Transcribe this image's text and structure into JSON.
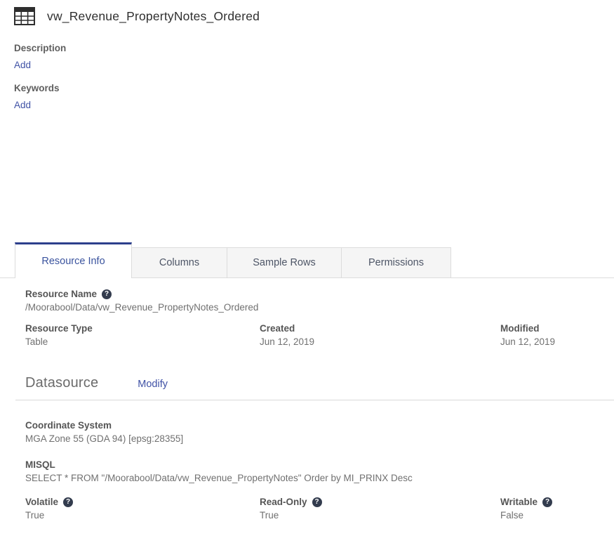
{
  "header": {
    "title": "vw_Revenue_PropertyNotes_Ordered"
  },
  "meta": {
    "description_label": "Description",
    "description_add": "Add",
    "keywords_label": "Keywords",
    "keywords_add": "Add"
  },
  "tabs": [
    {
      "label": "Resource Info",
      "active": true
    },
    {
      "label": "Columns",
      "active": false
    },
    {
      "label": "Sample Rows",
      "active": false
    },
    {
      "label": "Permissions",
      "active": false
    }
  ],
  "resource_info": {
    "resource_name": {
      "label": "Resource Name",
      "value": "/Moorabool/Data/vw_Revenue_PropertyNotes_Ordered"
    },
    "resource_type": {
      "label": "Resource Type",
      "value": "Table"
    },
    "created": {
      "label": "Created",
      "value": "Jun 12, 2019"
    },
    "modified": {
      "label": "Modified",
      "value": "Jun 12, 2019"
    }
  },
  "datasource": {
    "heading": "Datasource",
    "modify_label": "Modify",
    "coordinate_system": {
      "label": "Coordinate System",
      "value": "MGA Zone 55 (GDA 94) [epsg:28355]"
    },
    "misql": {
      "label": "MISQL",
      "value": "SELECT * FROM \"/Moorabool/Data/vw_Revenue_PropertyNotes\" Order by MI_PRINX Desc"
    },
    "volatile": {
      "label": "Volatile",
      "value": "True"
    },
    "read_only": {
      "label": "Read-Only",
      "value": "True"
    },
    "writable": {
      "label": "Writable",
      "value": "False"
    }
  },
  "icons": {
    "help_glyph": "?"
  },
  "colors": {
    "link_blue": "#3f51a5",
    "active_tab_border": "#2d3f8c",
    "active_tab_text": "#3a539e",
    "inactive_tab_bg": "#f5f5f5",
    "help_icon_bg": "#333c4e",
    "label_gray": "#555555",
    "value_gray": "#707070"
  }
}
